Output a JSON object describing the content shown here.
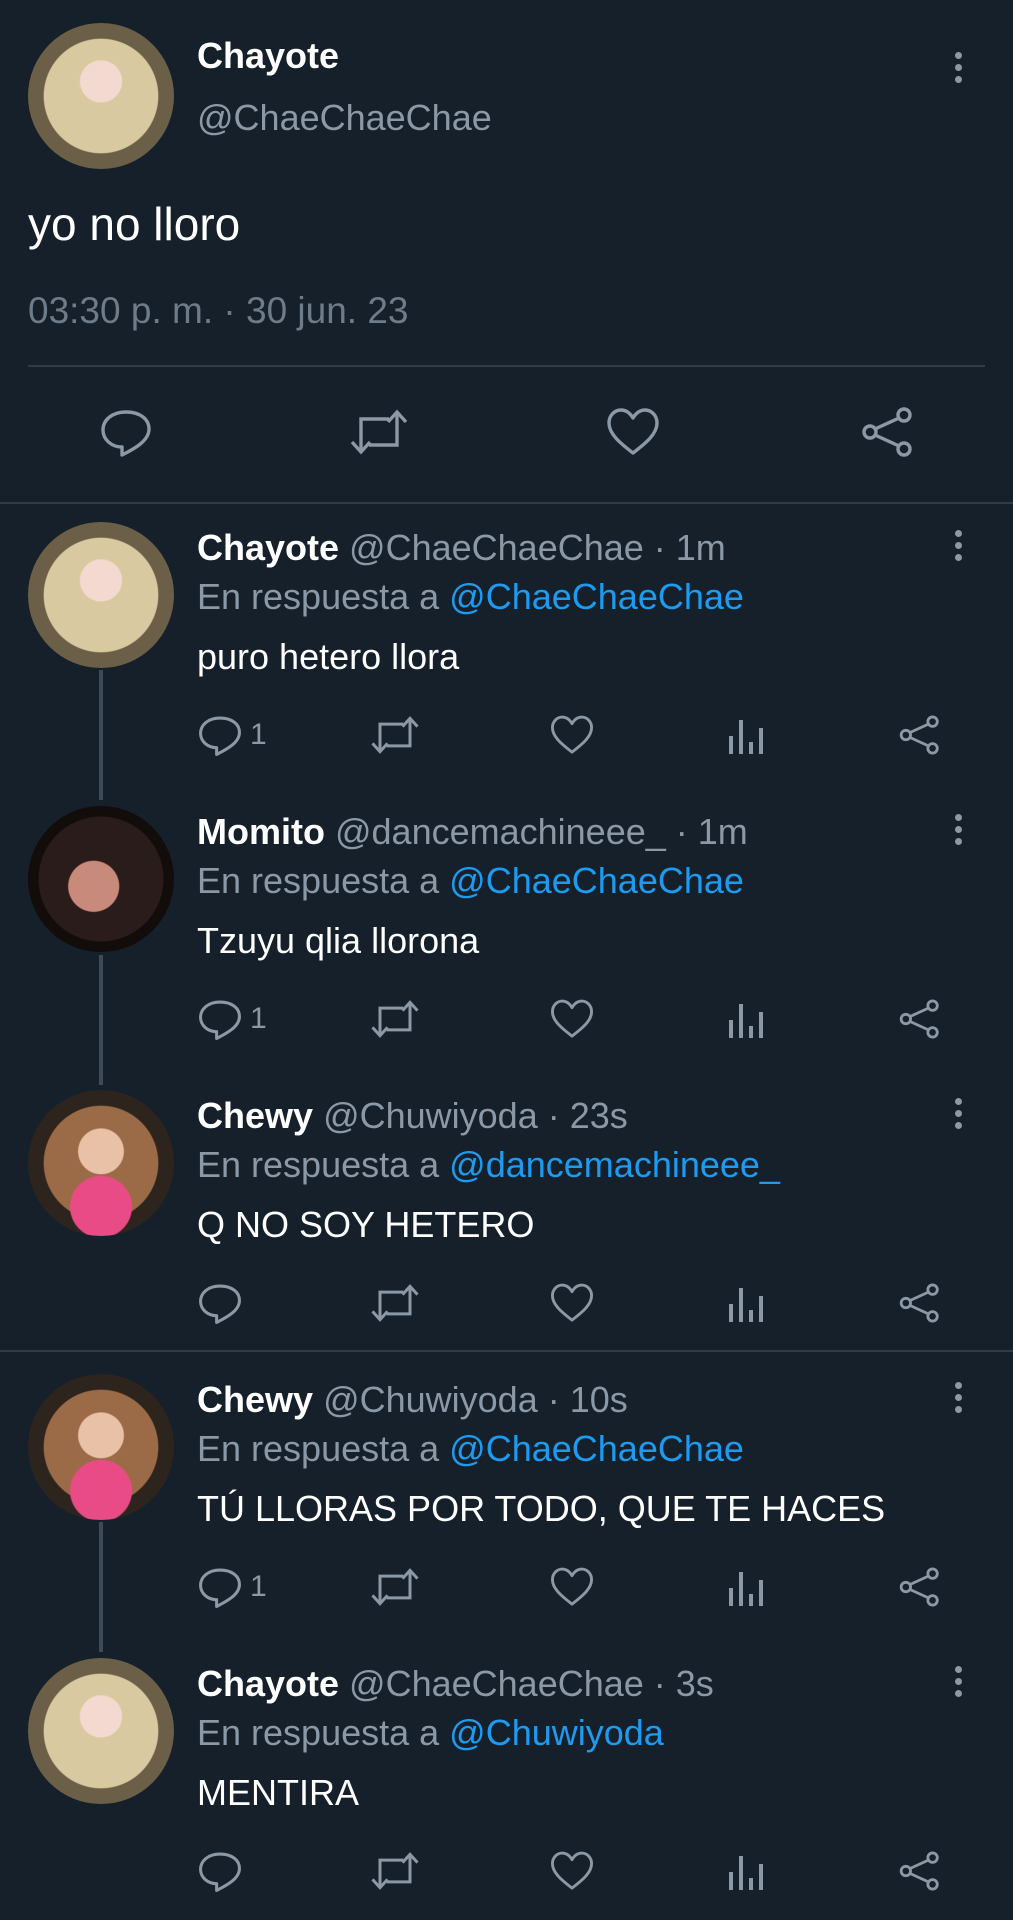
{
  "main_tweet": {
    "name": "Chayote",
    "handle": "@ChaeChaeChae",
    "text": "yo no lloro",
    "timestamp": "03:30 p. m. · 30 jun. 23"
  },
  "replies": [
    {
      "name": "Chayote",
      "handle": "@ChaeChaeChae",
      "time": "· 1m",
      "reply_prefix": "En respuesta a",
      "reply_to": "@ChaeChaeChae",
      "text": "puro hetero llora",
      "reply_count": "1",
      "avatar": "chayote-avatar"
    },
    {
      "name": "Momito",
      "handle": "@dancemachineee_",
      "time": "· 1m",
      "reply_prefix": "En respuesta a",
      "reply_to": "@ChaeChaeChae",
      "text": "Tzuyu qlia llorona",
      "reply_count": "1",
      "avatar": "momito-avatar"
    },
    {
      "name": "Chewy",
      "handle": "@Chuwiyoda",
      "time": "· 23s",
      "reply_prefix": "En respuesta a",
      "reply_to": "@dancemachineee_",
      "text": "Q NO SOY HETERO",
      "reply_count": "",
      "avatar": "chewy-avatar"
    },
    {
      "name": "Chewy",
      "handle": "@Chuwiyoda",
      "time": "· 10s",
      "reply_prefix": "En respuesta a",
      "reply_to": "@ChaeChaeChae",
      "text": "TÚ LLORAS POR TODO, QUE TE HACES",
      "reply_count": "1",
      "avatar": "chewy-avatar"
    },
    {
      "name": "Chayote",
      "handle": "@ChaeChaeChae",
      "time": "· 3s",
      "reply_prefix": "En respuesta a",
      "reply_to": "@Chuwiyoda",
      "text": "MENTIRA",
      "reply_count": "",
      "avatar": "chayote-avatar"
    }
  ],
  "colors": {
    "background": "#15202b",
    "secondary_text": "#8b98a5",
    "mention": "#1d9bf0",
    "divider": "#2f3b47"
  },
  "icons": [
    "reply-icon",
    "retweet-icon",
    "like-icon",
    "share-icon",
    "views-icon",
    "more-options-icon"
  ]
}
